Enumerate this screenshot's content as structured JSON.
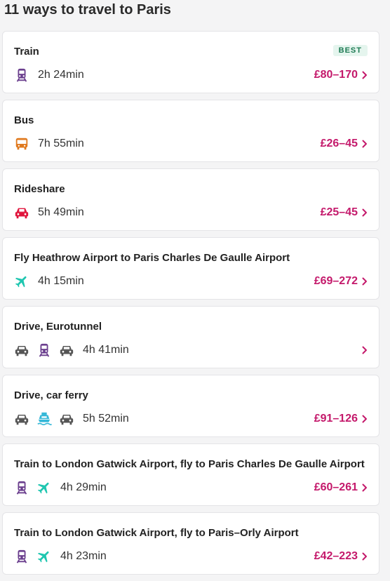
{
  "page": {
    "title": "11 ways to travel to Paris"
  },
  "colors": {
    "price": "#c4196b",
    "train": "#6b3f8e",
    "bus": "#e07a1f",
    "rideshare": "#e0143c",
    "flight": "#1fc6b0",
    "car": "#555555",
    "ferry": "#35b8d8"
  },
  "routes": [
    {
      "title": "Train",
      "badge": "BEST",
      "icons": [
        "train-icon"
      ],
      "duration": "2h 24min",
      "price": "£80–170"
    },
    {
      "title": "Bus",
      "badge": "",
      "icons": [
        "bus-icon"
      ],
      "duration": "7h 55min",
      "price": "£26–45"
    },
    {
      "title": "Rideshare",
      "badge": "",
      "icons": [
        "rideshare-car-icon"
      ],
      "duration": "5h 49min",
      "price": "£25–45"
    },
    {
      "title": "Fly Heathrow Airport to Paris Charles De Gaulle Airport",
      "badge": "",
      "icons": [
        "plane-icon"
      ],
      "duration": "4h 15min",
      "price": "£69–272"
    },
    {
      "title": "Drive, Eurotunnel",
      "badge": "",
      "icons": [
        "car-icon",
        "train-icon",
        "car-icon"
      ],
      "duration": "4h 41min",
      "price": ""
    },
    {
      "title": "Drive, car ferry",
      "badge": "",
      "icons": [
        "car-icon",
        "ferry-icon",
        "car-icon"
      ],
      "duration": "5h 52min",
      "price": "£91–126"
    },
    {
      "title": "Train to London Gatwick Airport, fly to Paris Charles De Gaulle Airport",
      "badge": "",
      "icons": [
        "train-icon",
        "plane-icon"
      ],
      "duration": "4h 29min",
      "price": "£60–261"
    },
    {
      "title": "Train to London Gatwick Airport, fly to Paris–Orly Airport",
      "badge": "",
      "icons": [
        "train-icon",
        "plane-icon"
      ],
      "duration": "4h 23min",
      "price": "£42–223"
    }
  ]
}
